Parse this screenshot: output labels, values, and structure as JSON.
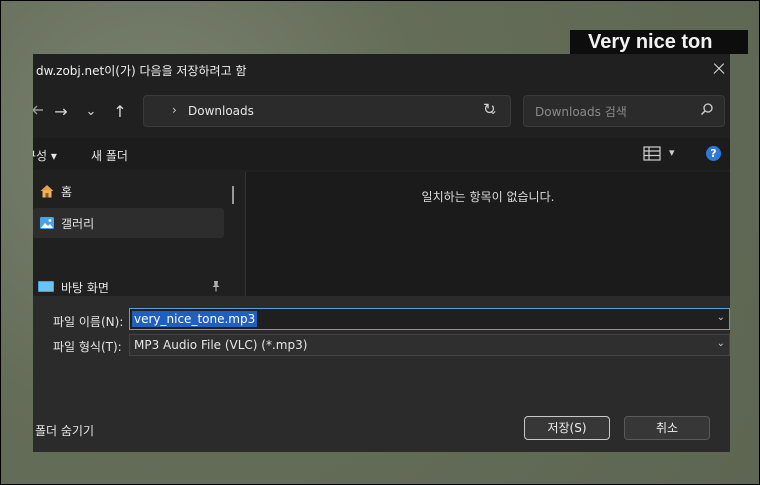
{
  "background": {
    "title_fragment": "Very nice ton"
  },
  "dialog": {
    "title": "dw.zobj.net이(가) 다음을 저장하려고 함",
    "nav": {
      "back_icon": "arrow-left-icon",
      "forward_glyph": "→",
      "recent_glyph": "⌄",
      "up_glyph": "↑"
    },
    "address": {
      "chevron": "›",
      "path": "Downloads",
      "dropdown": "⌄",
      "refresh": "↻"
    },
    "search": {
      "placeholder": "Downloads 검색"
    },
    "toolbar": {
      "organize": "구성 ▾",
      "new_folder": "새 폴더",
      "view_menu": "▾",
      "help": "?"
    },
    "sidebar": {
      "items": [
        {
          "label": "홈",
          "icon": "home-icon"
        },
        {
          "label": "갤러리",
          "icon": "gallery-icon",
          "selected": true
        },
        {
          "label": "바탕 화면",
          "icon": "desktop-icon",
          "pinned": true
        }
      ],
      "pin_glyph": "📌"
    },
    "file_area": {
      "empty_message": "일치하는 항목이 없습니다."
    },
    "form": {
      "filename_label": "파일 이름(N):",
      "filename_value": "very_nice_tone.mp3",
      "filetype_label": "파일 형식(T):",
      "filetype_value": "MP3 Audio File (VLC) (*.mp3)",
      "combo_chevron": "⌄"
    },
    "footer": {
      "hide_folders": "폴더 숨기기",
      "save_button": "저장(S)",
      "cancel_button": "취소"
    },
    "colors": {
      "selection": "#1f5fbf",
      "focus_border": "#5a9fe0",
      "help_blue": "#2d7ad6"
    }
  }
}
